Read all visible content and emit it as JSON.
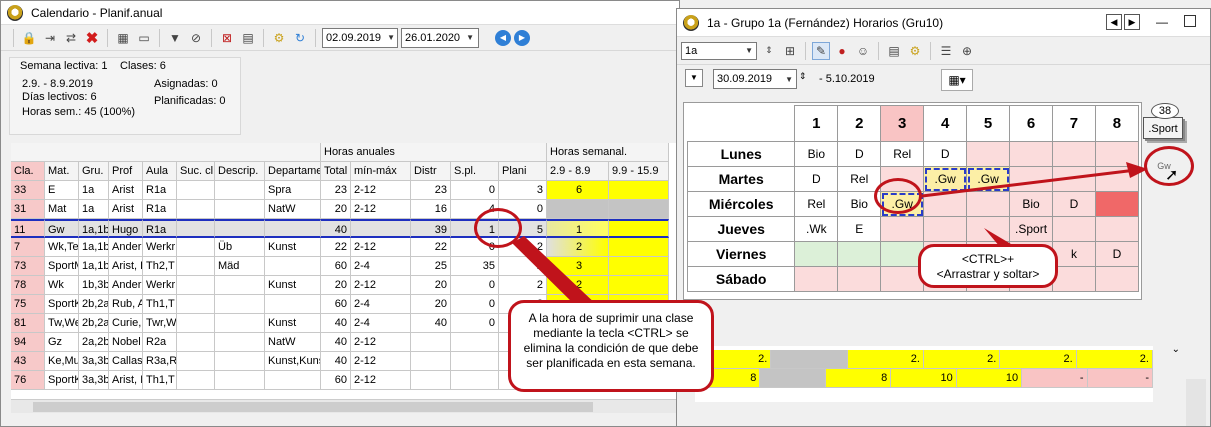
{
  "left_window": {
    "title": "Calendario - Planif.anual",
    "date_from": "02.09.2019",
    "date_to": "26.01.2020",
    "info": {
      "week": "Semana lectiva: 1",
      "classes": "Clases: 6",
      "range": "2.9. - 8.9.2019",
      "school_days": "Días lectivos: 6",
      "hours": "Horas sem.: 45 (100%)",
      "assigned": "Asignadas: 0",
      "planned": "Planificadas: 0"
    },
    "group_headers": {
      "annual": "Horas anuales",
      "weekly": "Horas semanal."
    },
    "columns": [
      "Cla.",
      "Mat.",
      "Gru.",
      "Prof",
      "Aula",
      "Suc. cl",
      "Descrip.",
      "Departame",
      "Total",
      "mín-máx",
      "Distr",
      "S.pl.",
      "Plani",
      "2.9 - 8.9",
      "9.9 - 15.9"
    ],
    "rows": [
      [
        "33",
        "E",
        "1a",
        "Arist",
        "R1a",
        "",
        "",
        "Spra",
        "23",
        "2-12",
        "23",
        "0",
        "3",
        "6",
        ""
      ],
      [
        "31",
        "Mat",
        "1a",
        "Arist",
        "R1a",
        "",
        "",
        "NatW",
        "20",
        "2-12",
        "16",
        "4",
        "0",
        "",
        ""
      ],
      [
        "11",
        "Gw",
        "1a,1b,",
        "Hugo",
        "R1a",
        "",
        "",
        "",
        "40",
        "",
        "39",
        "1",
        "5",
        "1",
        ""
      ],
      [
        "7",
        "Wk,Te",
        "1a,1b,",
        "Ander",
        "Werkr",
        "",
        "Üb",
        "Kunst",
        "22",
        "2-12",
        "22",
        "0",
        "2",
        "2",
        ""
      ],
      [
        "73",
        "SportM",
        "1a,1b,",
        "Arist, F",
        "Th2,T",
        "",
        "Mäd",
        "",
        "60",
        "2-4",
        "25",
        "35",
        "2",
        "3",
        ""
      ],
      [
        "78",
        "Wk",
        "1b,3b",
        "Ander",
        "Werkr",
        "",
        "",
        "Kunst",
        "20",
        "2-12",
        "20",
        "0",
        "2",
        "2",
        ""
      ],
      [
        "75",
        "SportK",
        "2b,2a",
        "Rub, A",
        "Th1,T",
        "",
        "",
        "",
        "60",
        "2-4",
        "20",
        "0",
        "2",
        "2",
        ""
      ],
      [
        "81",
        "Tw,We",
        "2b,2a",
        "Curie,",
        "Twr,W",
        "",
        "",
        "Kunst",
        "40",
        "2-4",
        "40",
        "0",
        "2",
        "2",
        ""
      ],
      [
        "94",
        "Gz",
        "2a,2b",
        "Nobel",
        "R2a",
        "",
        "",
        "NatW",
        "40",
        "2-12",
        "",
        "",
        "",
        "",
        ""
      ],
      [
        "43",
        "Ke,Mu",
        "3a,3b",
        "Callas",
        "R3a,R",
        "",
        "",
        "Kunst,Kuns",
        "40",
        "2-12",
        "",
        "",
        "",
        "",
        ""
      ],
      [
        "76",
        "SportK",
        "3a,3b",
        "Arist, I",
        "Th1,T",
        "",
        "",
        "",
        "60",
        "2-12",
        "",
        "",
        "",
        "",
        ""
      ]
    ],
    "callout": "A la hora de suprimir una clase mediante la tecla <CTRL> se elimina la condición de que debe ser planificada en esta semana."
  },
  "right_window": {
    "title": "1a - Grupo 1a (Fernández)  Horarios  (Gru10)",
    "class_select": "1a",
    "week_date": "30.09.2019",
    "week_end": "- 5.10.2019",
    "periods": [
      "1",
      "2",
      "3",
      "4",
      "5",
      "6",
      "7",
      "8"
    ],
    "days": [
      "Lunes",
      "Martes",
      "Miércoles",
      "Jueves",
      "Viernes",
      "Sábado"
    ],
    "grid": [
      [
        "Bio",
        "D",
        "Rel",
        "D",
        "",
        "",
        "",
        ""
      ],
      [
        "D",
        "Rel",
        "",
        ".Gw",
        ".Gw",
        "",
        "",
        ""
      ],
      [
        "Rel",
        "Bio",
        ".Gw",
        "",
        "",
        "Bio",
        "D",
        ""
      ],
      [
        ".Wk",
        "E",
        "",
        "",
        "",
        ".Sport",
        "",
        ""
      ],
      [
        "",
        "",
        "",
        "",
        "",
        "",
        "k",
        "D"
      ],
      [
        "",
        "",
        "",
        "",
        "",
        "",
        "",
        ""
      ]
    ],
    "callout": "<CTRL>+\n<Arrastrar y soltar>",
    "sport_count": "38",
    "sport_label": ".Sport",
    "drop_label": "Gw",
    "bottom_values": [
      "2.",
      "",
      "2.",
      "2.",
      "2.",
      "2.",
      "8",
      "",
      "8",
      "10",
      "10",
      "-",
      "-"
    ]
  },
  "colors": {
    "accent": "#c0131b",
    "yellow": "#ffff00",
    "selection": "#1e2fbf"
  }
}
